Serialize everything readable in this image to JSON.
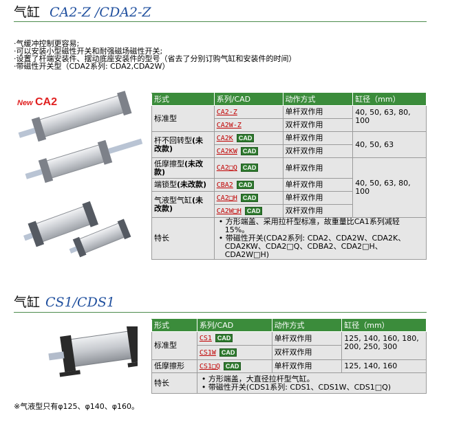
{
  "section1": {
    "title_cn": "气缸",
    "title_model": "CA2-Z /CDA2-Z",
    "bullets": [
      "·气缓冲控制更容易;",
      "·可以安装小型磁性开关和耐强磁场磁性开关;",
      "·设置了杆端安装件、摆动底座安装件的型号（省去了分别订购气缸和安装件的时间）",
      "·带磁性开关型（CDA2系列: CDA2,CDA2W）"
    ],
    "image_label_new": "New",
    "image_label_model": "CA2",
    "table": {
      "headers": [
        "形式",
        "系列/CAD",
        "动作方式",
        "缸径（mm）"
      ],
      "cad_label": "CAD",
      "rows": [
        {
          "type": "标准型",
          "series": "CA2-Z",
          "cad": false,
          "action": "单杆双作用",
          "bore": "40, 50, 63, 80, 100"
        },
        {
          "type": "",
          "series": "CA2W-Z",
          "cad": false,
          "action": "双杆双作用",
          "bore": ""
        },
        {
          "type": "杆不回转型(未改款)",
          "series": "CA2K",
          "cad": true,
          "action": "单杆双作用",
          "bore": "40, 50, 63"
        },
        {
          "type": "",
          "series": "CA2KW",
          "cad": true,
          "action": "双杆双作用",
          "bore": ""
        },
        {
          "type": "低摩擦型(未改款)",
          "series": "CA2□Q",
          "cad": true,
          "action": "单杆双作用",
          "bore": "40, 50, 63, 80, 100"
        },
        {
          "type": "端锁型(未改款)",
          "series": "CBA2",
          "cad": true,
          "action": "单杆双作用",
          "bore": ""
        },
        {
          "type": "气液型气缸(未改款)",
          "series": "CA2□H",
          "cad": true,
          "action": "单杆双作用",
          "bore": ""
        },
        {
          "type": "",
          "series": "CA2W□H",
          "cad": true,
          "action": "双杆双作用",
          "bore": ""
        }
      ],
      "type_labels": {
        "standard": "标准型",
        "nonrotate_a": "杆不回转型",
        "nonrotate_b": "(未",
        "nonrotate_c": "改款)",
        "lowfric_a": "低摩擦型",
        "lowfric_b": "(未改",
        "lowfric_c": "款)",
        "endlock_a": "端锁型",
        "endlock_b": "(未改款)",
        "airhyd_a": "气液型气缸",
        "airhyd_b": "(未",
        "airhyd_c": "改款)"
      },
      "features_label": "特长",
      "features": [
        "• 方形端盖、采用拉杆型标准，故重量比CA1系列减轻15%。",
        "• 带磁性开关(CDA2系列: CDA2、CDA2W、CDA2K、CDA2KW、CDA2□Q、CDBA2、CDA2□H、CDA2W□H)"
      ]
    }
  },
  "section2": {
    "title_cn": "气缸",
    "title_model": "CS1/CDS1",
    "table": {
      "headers": [
        "形式",
        "系列/CAD",
        "动作方式",
        "缸径（mm）"
      ],
      "cad_label": "CAD",
      "rows": [
        {
          "type": "标准型",
          "series": "CS1",
          "cad": true,
          "action": "单杆双作用",
          "bore": "125, 140, 160, 180, 200, 250, 300"
        },
        {
          "type": "",
          "series": "CS1W",
          "cad": true,
          "action": "双杆双作用",
          "bore": ""
        },
        {
          "type": "低摩擦形",
          "series": "CS1□Q",
          "cad": true,
          "action": "单杆双作用",
          "bore": "125, 140, 160"
        }
      ],
      "features_label": "特长",
      "features": [
        "• 方形端盖，大直径拉杆型气缸。",
        "• 带磁性开关(CDS1系列: CDS1、CDS1W、CDS1□Q)"
      ]
    },
    "note": "※气液型只有φ125、φ140、φ160。"
  }
}
